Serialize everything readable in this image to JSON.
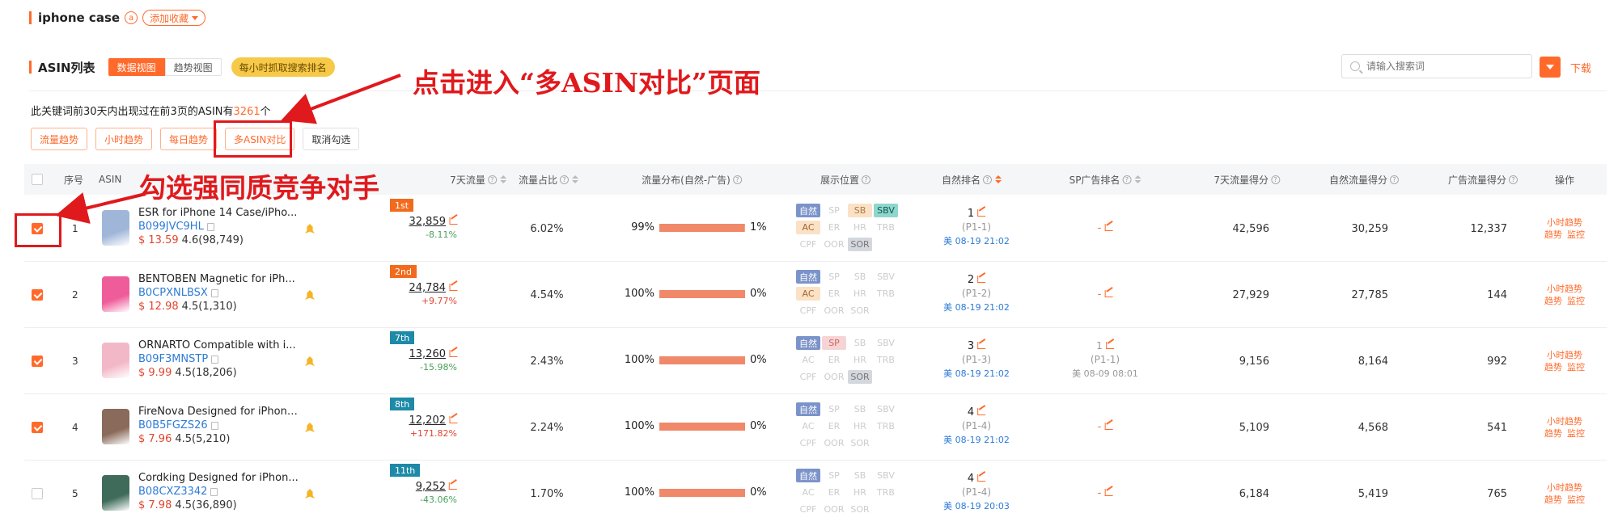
{
  "keyword": {
    "title": "iphone case",
    "badge": "a",
    "fav_label": "添加收藏"
  },
  "section": {
    "title": "ASIN列表",
    "view_data": "数据视图",
    "view_trend": "趋势视图",
    "hourly": "每小时抓取搜索排名"
  },
  "search": {
    "placeholder": "请输入搜索词",
    "download": "下载"
  },
  "info": {
    "prefix": "此关键词前30天内出现过在前3页的ASIN有",
    "count": "3261",
    "suffix": "个"
  },
  "actions": {
    "traffic_trend": "流量趋势",
    "hourly_trend": "小时趋势",
    "daily_trend": "每日趋势",
    "compare": "多ASIN对比",
    "clear": "取消勾选"
  },
  "headers": {
    "index": "序号",
    "asin": "ASIN",
    "traffic7": "7天流量",
    "share": "流量占比",
    "dist": "流量分布(自然-广告)",
    "position": "展示位置",
    "nat_rank": "自然排名",
    "sp_rank": "SP广告排名",
    "score7": "7天流量得分",
    "nat_score": "自然流量得分",
    "ad_score": "广告流量得分",
    "ops": "操作"
  },
  "pos_labels": [
    "自然",
    "SP",
    "SB",
    "SBV",
    "AC",
    "ER",
    "HR",
    "TRB",
    "CPF",
    "OOR",
    "SOR"
  ],
  "rows": [
    {
      "checked": true,
      "index": "1",
      "title": "ESR for iPhone 14 Case/iPho...",
      "asin": "B099JVC9HL",
      "price": "$ 13.59",
      "rating": "4.6(98,749)",
      "rank_badge": "1st",
      "badge_color": "#f26b1d",
      "traffic": "32,859",
      "change": "-8.11%",
      "change_dir": "neg",
      "share": "6.02%",
      "nat_pct": "99%",
      "ad_pct": "1%",
      "nat_fill": 0.99,
      "pos": {
        "自然": "n",
        "SB": "sb",
        "SBV": "sbv",
        "AC": "ac",
        "SOR": "sor"
      },
      "nat_rank": "1",
      "nat_page": "(P1-1)",
      "nat_time": "美 08-19 21:02",
      "sp_rank": "-",
      "sp_page": "",
      "sp_time": "",
      "score7": "42,596",
      "nat_score": "30,259",
      "ad_score": "12,337"
    },
    {
      "checked": true,
      "index": "2",
      "title": "BENTOBEN Magnetic for iPh...",
      "asin": "B0CPXNLBSX",
      "price": "$ 12.98",
      "rating": "4.5(1,310)",
      "rank_badge": "2nd",
      "badge_color": "#f26b1d",
      "traffic": "24,784",
      "change": "+9.77%",
      "change_dir": "pos",
      "share": "4.54%",
      "nat_pct": "100%",
      "ad_pct": "0%",
      "nat_fill": 1.0,
      "pos": {
        "自然": "n",
        "AC": "ac"
      },
      "nat_rank": "2",
      "nat_page": "(P1-2)",
      "nat_time": "美 08-19 21:02",
      "sp_rank": "-",
      "sp_page": "",
      "sp_time": "",
      "score7": "27,929",
      "nat_score": "27,785",
      "ad_score": "144"
    },
    {
      "checked": true,
      "index": "3",
      "title": "ORNARTO Compatible with i...",
      "asin": "B09F3MNSTP",
      "price": "$ 9.99",
      "rating": "4.5(18,206)",
      "rank_badge": "7th",
      "badge_color": "#1e8aa8",
      "traffic": "13,260",
      "change": "-15.98%",
      "change_dir": "neg",
      "share": "2.43%",
      "nat_pct": "100%",
      "ad_pct": "0%",
      "nat_fill": 1.0,
      "pos": {
        "自然": "n",
        "SP": "sp",
        "SOR": "sor"
      },
      "nat_rank": "3",
      "nat_page": "(P1-3)",
      "nat_time": "美 08-19 21:02",
      "sp_rank": "1",
      "sp_page": "(P1-1)",
      "sp_time": "美 08-09 08:01",
      "score7": "9,156",
      "nat_score": "8,164",
      "ad_score": "992"
    },
    {
      "checked": true,
      "index": "4",
      "title": "FireNova Designed for iPhone...",
      "asin": "B0B5FGZS26",
      "price": "$ 7.96",
      "rating": "4.5(5,210)",
      "rank_badge": "8th",
      "badge_color": "#1e8aa8",
      "traffic": "12,202",
      "change": "+171.82%",
      "change_dir": "pos",
      "share": "2.24%",
      "nat_pct": "100%",
      "ad_pct": "0%",
      "nat_fill": 1.0,
      "pos": {
        "自然": "n"
      },
      "nat_rank": "4",
      "nat_page": "(P1-4)",
      "nat_time": "美 08-19 21:02",
      "sp_rank": "-",
      "sp_page": "",
      "sp_time": "",
      "score7": "5,109",
      "nat_score": "4,568",
      "ad_score": "541"
    },
    {
      "checked": false,
      "index": "5",
      "title": "Cordking Designed for iPhon...",
      "asin": "B08CXZ3342",
      "price": "$ 7.98",
      "rating": "4.5(36,890)",
      "rank_badge": "11th",
      "badge_color": "#1e8aa8",
      "traffic": "9,252",
      "change": "-43.06%",
      "change_dir": "neg",
      "share": "1.70%",
      "nat_pct": "100%",
      "ad_pct": "0%",
      "nat_fill": 1.0,
      "pos": {
        "自然": "n"
      },
      "nat_rank": "4",
      "nat_page": "(P1-4)",
      "nat_time": "美 08-19 20:03",
      "sp_rank": "-",
      "sp_page": "",
      "sp_time": "",
      "score7": "6,184",
      "nat_score": "5,419",
      "ad_score": "765"
    }
  ],
  "row_ops": {
    "hourly": "小时趋势",
    "trend": "趋势",
    "monitor": "监控"
  },
  "thumb_colors": [
    "#9fb6d9",
    "#ef5c9a",
    "#f3b8c8",
    "#8a6a5a",
    "#3f6b5a"
  ],
  "annotations": {
    "compare_hint": "点击进入“多ASIN对比”页面",
    "select_hint": "勾选强同质竞争对手"
  }
}
